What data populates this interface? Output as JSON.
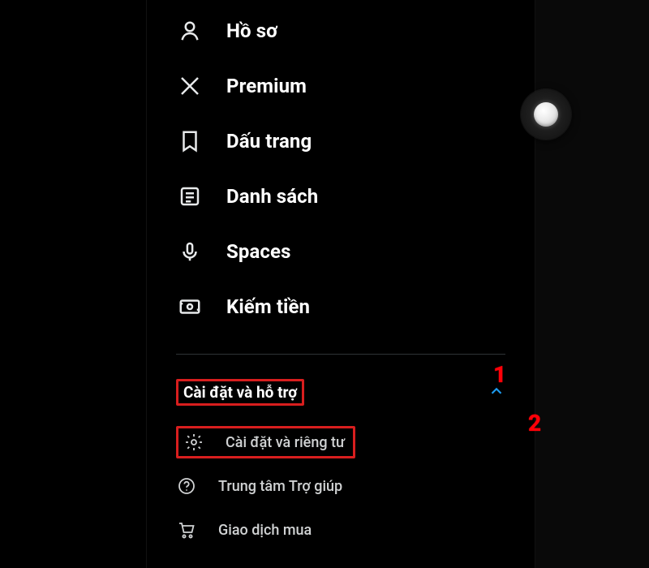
{
  "nav": {
    "items": [
      {
        "icon": "person-icon",
        "label": "Hồ sơ"
      },
      {
        "icon": "x-icon",
        "label": "Premium"
      },
      {
        "icon": "bookmark-icon",
        "label": "Dấu trang"
      },
      {
        "icon": "list-icon",
        "label": "Danh sách"
      },
      {
        "icon": "mic-icon",
        "label": "Spaces"
      },
      {
        "icon": "money-icon",
        "label": "Kiếm tiền"
      }
    ]
  },
  "section": {
    "title": "Cài đặt và hỗ trợ",
    "expanded": true,
    "items": [
      {
        "icon": "gear-icon",
        "label": "Cài đặt và riêng tư",
        "highlighted": true
      },
      {
        "icon": "help-icon",
        "label": "Trung tâm Trợ giúp"
      },
      {
        "icon": "cart-icon",
        "label": "Giao dịch mua"
      }
    ]
  },
  "annotations": {
    "one": "1",
    "two": "2"
  },
  "colors": {
    "highlight": "#d81e1e",
    "accent": "#1d9bf0",
    "background": "#000000",
    "text": "#e7e9ea"
  }
}
